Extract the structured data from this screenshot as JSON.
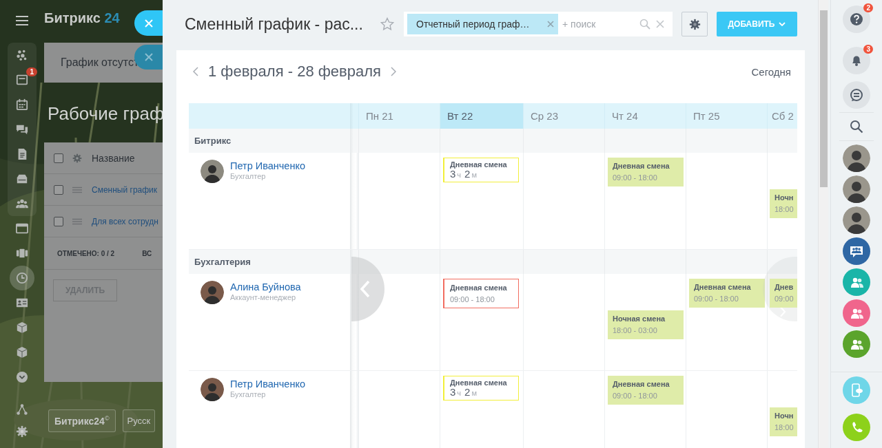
{
  "background_page": {
    "logo": {
      "text": "Битрикс",
      "number": "24"
    },
    "nav_items": [
      {
        "selected": false
      },
      {
        "selected": false,
        "badge": "1"
      },
      {
        "selected": false
      },
      {
        "selected": false
      },
      {
        "selected": false
      },
      {
        "selected": false
      },
      {
        "selected": false
      },
      {
        "selected": false
      },
      {
        "selected": false
      },
      {
        "selected": true
      },
      {
        "selected": false
      },
      {
        "selected": false
      },
      {
        "selected": false
      },
      {
        "selected": false
      },
      {
        "selected": false
      },
      {
        "selected": false
      }
    ],
    "tab": "График отсутст",
    "heading": "Рабочие граф",
    "table": {
      "header_checked": false,
      "column": "Название",
      "rows": [
        {
          "name": "Сменный график",
          "checked": false
        },
        {
          "name": "Для всех сотрудн",
          "checked": false
        }
      ],
      "footer": {
        "label": "ОТМЕЧЕНО:",
        "count": "0 / 2",
        "column_2": "ВС"
      }
    },
    "delete_button": "УДАЛИТЬ",
    "footer_buttons": [
      "Битрикс24$^{©}$",
      "Русск"
    ]
  },
  "panel": {
    "title": "Сменный график - рас...",
    "favorite": false,
    "filter": {
      "tags": [
        {
          "label": "Отчетный период граф…"
        }
      ],
      "placeholder": "+ поиск"
    },
    "add_button": "ДОБАВИТЬ"
  },
  "calendar": {
    "period": "1 февраля - 28 февраля",
    "today_button": "Сегодня",
    "days": [
      {
        "label": "Пн 21",
        "selected": false
      },
      {
        "label": "Вт 22",
        "selected": true
      },
      {
        "label": "Ср 23",
        "selected": false
      },
      {
        "label": "Чт 24",
        "selected": false
      },
      {
        "label": "Пт 25",
        "selected": false
      },
      {
        "label": "Сб 2",
        "selected": false
      }
    ],
    "groups": [
      {
        "name": "Битрикс",
        "employees": [
          {
            "name": "Петр Иванченко",
            "position": "Бухгалтер",
            "cells": [
              {},
              {
                "top": {
                  "kind": "worked",
                  "title": "Дневная смена",
                  "duration": {
                    "hours": "3",
                    "hours_unit": "ч",
                    "minutes": "2",
                    "minutes_unit": "м"
                  }
                }
              },
              {},
              {
                "top": {
                  "kind": "planned",
                  "title": "Дневная смена",
                  "time": "09:00 - 18:00"
                }
              },
              {},
              {
                "bottom": {
                  "kind": "planned",
                  "title": "Ночн",
                  "time": "18:00"
                }
              }
            ]
          }
        ]
      },
      {
        "name": "Бухгалтерия",
        "employees": [
          {
            "name": "Алина Буйнова",
            "position": "Аккаунт-менеджер",
            "cells": [
              {},
              {
                "top": {
                  "kind": "missed",
                  "title": "Дневная смена",
                  "time": "09:00 - 18:00"
                }
              },
              {},
              {
                "bottom": {
                  "kind": "planned",
                  "title": "Ночная смена",
                  "time": "18:00 - 03:00"
                }
              },
              {
                "top": {
                  "kind": "planned",
                  "title": "Дневная смена",
                  "time": "09:00 - 18:00"
                }
              },
              {
                "top": {
                  "kind": "planned",
                  "title": "Днев",
                  "time": "09:00"
                }
              }
            ]
          },
          {
            "name": "Петр Иванченко",
            "position": "Бухгалтер",
            "cells": [
              {},
              {
                "top": {
                  "kind": "worked",
                  "title": "Дневная смена",
                  "duration": {
                    "hours": "3",
                    "hours_unit": "ч",
                    "minutes": "2",
                    "minutes_unit": "м"
                  }
                }
              },
              {},
              {
                "top": {
                  "kind": "planned",
                  "title": "Дневная смена",
                  "time": "09:00 - 18:00"
                }
              },
              {},
              {
                "bottom": {
                  "kind": "planned",
                  "title": "Ночн",
                  "time": "18:00"
                }
              }
            ]
          }
        ]
      }
    ]
  },
  "sidebar": {
    "items": [
      {
        "kind": "help",
        "badge": "2"
      },
      {
        "kind": "notifications",
        "badge": "3"
      },
      {
        "kind": "messages"
      },
      {
        "kind": "search"
      },
      {
        "kind": "avatar"
      },
      {
        "kind": "avatar"
      },
      {
        "kind": "avatar"
      },
      {
        "kind": "group_chat",
        "color": "#2f67a4"
      },
      {
        "kind": "group",
        "color": "#1ab5a8"
      },
      {
        "kind": "group",
        "color": "#f0658c"
      },
      {
        "kind": "group",
        "color": "#5ba42c"
      }
    ],
    "bottom_items": [
      {
        "kind": "phone_cloud",
        "color": "#6fd6e8"
      },
      {
        "kind": "call",
        "color": "#8dd11b"
      }
    ]
  }
}
